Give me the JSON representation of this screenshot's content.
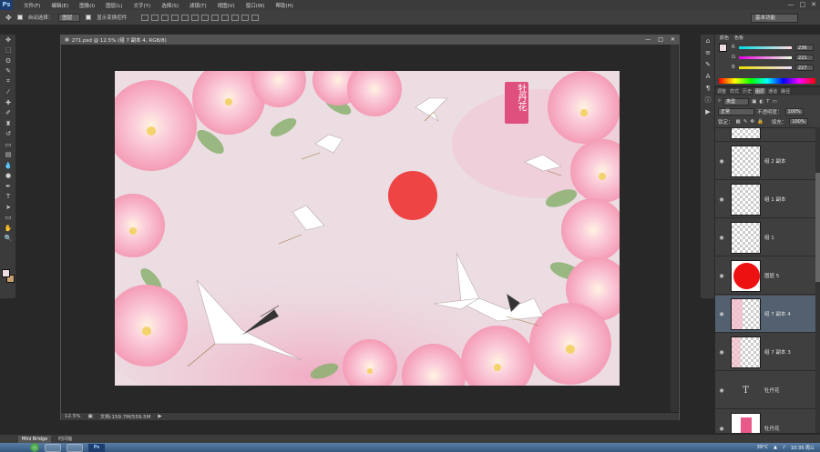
{
  "menubar": {
    "logo": "Ps",
    "items": [
      "文件(F)",
      "编辑(E)",
      "图像(I)",
      "图层(L)",
      "文字(Y)",
      "选择(S)",
      "滤镜(T)",
      "视图(V)",
      "窗口(W)",
      "帮助(H)"
    ],
    "window_controls": [
      "—",
      "□",
      "✕"
    ]
  },
  "options": {
    "auto_select_label": "自动选择：",
    "auto_select_value": "图层",
    "show_transform_label": "显示变换控件",
    "workspace": "基本功能"
  },
  "document": {
    "title": "271.psd @ 12.5% (组 7 副本 4, RGB/8)",
    "controls": [
      "—",
      "□",
      "✕"
    ],
    "zoom": "12.5%",
    "doc_size": "文档:159.7M/559.5M"
  },
  "canvas": {
    "seal_text": "牡丹花",
    "sun_color": "#ee4444",
    "bg_color": "#ecdde3",
    "flower_color": "#f5bccb"
  },
  "color_panel": {
    "tabs": [
      "颜色",
      "色板"
    ],
    "r_label": "R",
    "g_label": "G",
    "b_label": "B",
    "r": "236",
    "g": "221",
    "b": "227"
  },
  "layers_panel": {
    "tabs": [
      "调整",
      "样式",
      "历史",
      "图层",
      "通道",
      "路径"
    ],
    "kind_label": "类型",
    "blend_mode": "正常",
    "opacity_label": "不透明度：",
    "opacity": "100%",
    "lock_label": "锁定：",
    "fill_label": "填充：",
    "fill": "100%",
    "layers": [
      {
        "name": "",
        "type": "image"
      },
      {
        "name": "组 2 副本",
        "type": "image"
      },
      {
        "name": "组 1 副本",
        "type": "image"
      },
      {
        "name": "组 1",
        "type": "image"
      },
      {
        "name": "图层 5",
        "type": "red-circle"
      },
      {
        "name": "组 7 副本 4",
        "type": "image",
        "selected": true
      },
      {
        "name": "组 7 副本 3",
        "type": "image"
      },
      {
        "name": "牡丹花",
        "type": "text"
      },
      {
        "name": "牡丹花",
        "type": "seal"
      }
    ]
  },
  "minibridge": {
    "tabs": [
      "Mini Bridge",
      "时间轴"
    ]
  },
  "taskbar": {
    "temp": "39°C",
    "time": "10:35 周三"
  }
}
